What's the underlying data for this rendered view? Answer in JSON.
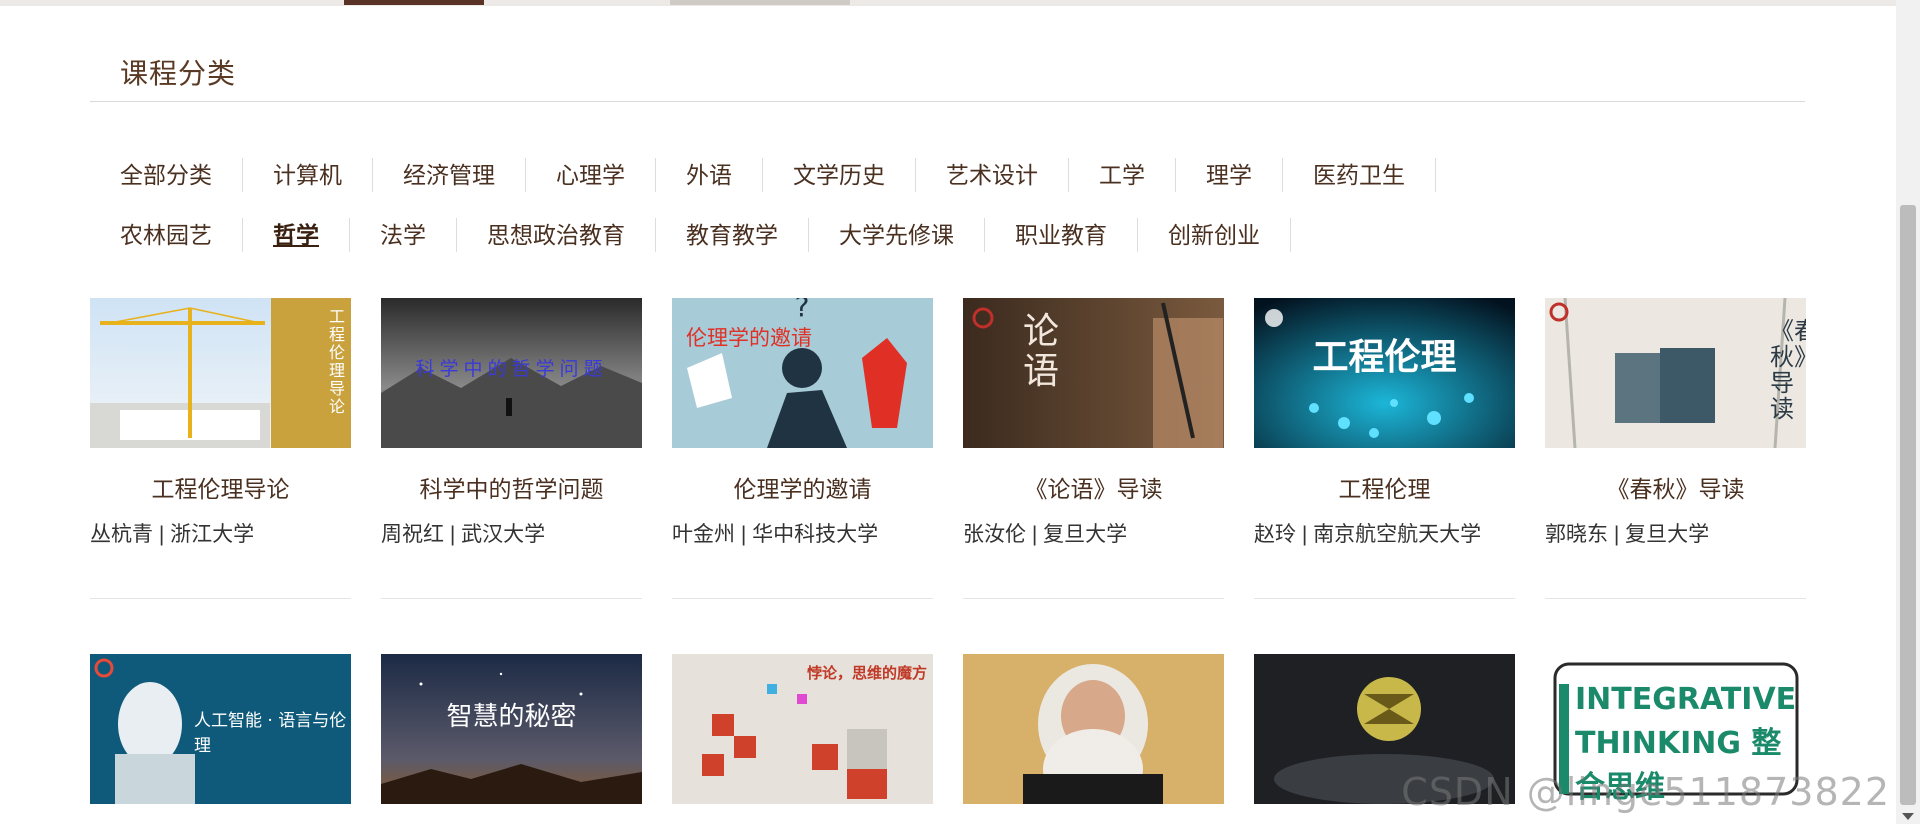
{
  "section": {
    "title": "课程分类"
  },
  "categories": {
    "row1": [
      "全部分类",
      "计算机",
      "经济管理",
      "心理学",
      "外语",
      "文学历史",
      "艺术设计",
      "工学",
      "理学",
      "医药卫生"
    ],
    "row2": [
      "农林园艺",
      "哲学",
      "法学",
      "思想政治教育",
      "教育教学",
      "大学先修课",
      "职业教育",
      "创新创业"
    ],
    "active": "哲学"
  },
  "courses": [
    {
      "name": "工程伦理导论",
      "meta": "丛杭青 | 浙江大学",
      "cover_text": "工程伦理导论"
    },
    {
      "name": "科学中的哲学问题",
      "meta": "周祝红 | 武汉大学",
      "cover_text": "科学中的哲学问题"
    },
    {
      "name": "伦理学的邀请",
      "meta": "叶金州 | 华中科技大学",
      "cover_text": "伦理学的邀请"
    },
    {
      "name": "《论语》导读",
      "meta": "张汝伦 | 复旦大学",
      "cover_text": "论语"
    },
    {
      "name": "工程伦理",
      "meta": "赵玲 | 南京航空航天大学",
      "cover_text": "工程伦理"
    },
    {
      "name": "《春秋》导读",
      "meta": "郭晓东 | 复旦大学",
      "cover_text": "《春秋》导读"
    },
    {
      "name": "",
      "meta": "",
      "cover_text": "人工智能 · 语言与伦理"
    },
    {
      "name": "",
      "meta": "",
      "cover_text": "智慧的秘密"
    },
    {
      "name": "",
      "meta": "",
      "cover_text": "悖论，思维的魔方"
    },
    {
      "name": "",
      "meta": "",
      "cover_text": ""
    },
    {
      "name": "",
      "meta": "",
      "cover_text": ""
    },
    {
      "name": "",
      "meta": "",
      "cover_text": "INTEGRATIVE THINKING 整合思维"
    }
  ],
  "watermark": "CSDN @linge511873822"
}
